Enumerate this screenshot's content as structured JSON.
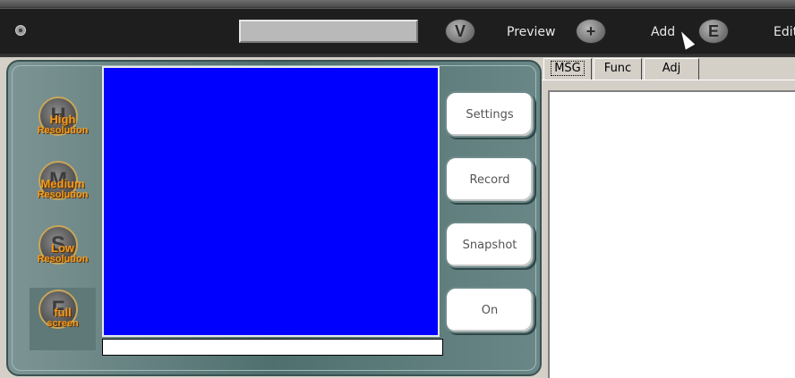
{
  "toolbar": {
    "address_value": "",
    "buttons": [
      {
        "name": "preview",
        "label": "Preview",
        "icon": "V"
      },
      {
        "name": "add",
        "label": "Add",
        "icon": "+"
      },
      {
        "name": "edit",
        "label": "Edit",
        "icon": "E"
      }
    ]
  },
  "resolution": {
    "high": {
      "letter": "H",
      "line1": "High",
      "line2": "Resolution"
    },
    "medium": {
      "letter": "M",
      "line1": "Medium",
      "line2": "Resolution"
    },
    "low": {
      "letter": "S",
      "line1": "Low",
      "line2": "Resolution"
    },
    "full": {
      "letter": "F",
      "line1": "full",
      "line2": "screen"
    }
  },
  "controls": {
    "settings": "Settings",
    "record": "Record",
    "snapshot": "Snapshot",
    "on": "On"
  },
  "tabs": [
    "MSG",
    "Func",
    "Adj"
  ],
  "colors": {
    "video_bg": "#0000ff",
    "accent": "#f19a1e"
  }
}
